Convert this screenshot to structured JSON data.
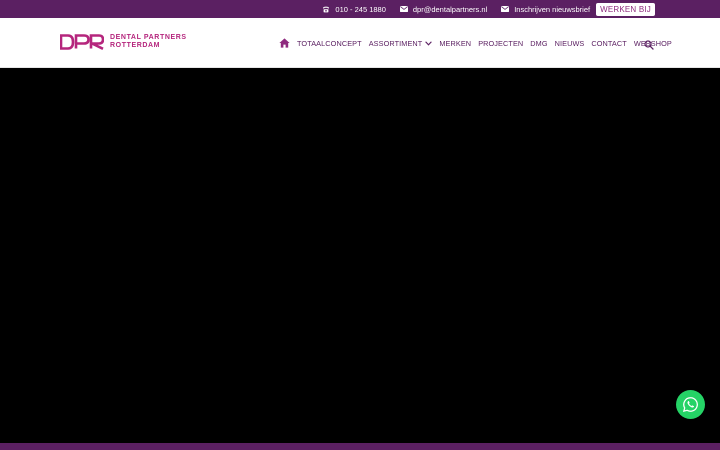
{
  "colors": {
    "brand_purple": "#5b2062",
    "brand_pink": "#b5267d",
    "whatsapp_green": "#25d366",
    "hero": "#000000"
  },
  "topbar": {
    "phone": {
      "icon": "phone-icon",
      "label": "010 - 245 1880"
    },
    "email": {
      "icon": "mail-icon",
      "label": "dpr@dentalpartners.nl"
    },
    "newsletter": {
      "icon": "mail-icon",
      "label": "Inschrijven nieuwsbrief"
    },
    "jobs_label": "WERKEN BIJ"
  },
  "logo": {
    "mark": "DPR",
    "line1": "DENTAL PARTNERS",
    "line2": "ROTTERDAM"
  },
  "nav": {
    "home_icon": "home-icon",
    "items": [
      "TOTAALCONCEPT",
      "ASSORTIMENT",
      "MERKEN",
      "PROJECTEN",
      "DMG",
      "NIEUWS",
      "CONTACT",
      "WEBSHOP"
    ],
    "search_icon": "search-icon"
  },
  "floating": {
    "icon": "whatsapp-icon"
  }
}
